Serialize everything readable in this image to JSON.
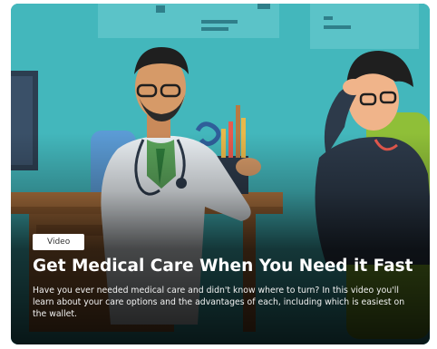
{
  "card": {
    "badge": "Video",
    "title": "Get Medical Care When You Need it Fast",
    "description": "Have you ever needed medical care and didn't know where to turn? In this video you'll learn about your care options and the advantages of each, including which is easiest on the wallet."
  },
  "colors": {
    "background_teal": "#3fb3b8",
    "doctor_coat": "#e9eef2",
    "desk_wood": "#b87a43",
    "chair_green": "#7fae2e",
    "patient_shirt": "#2d3a4a"
  }
}
